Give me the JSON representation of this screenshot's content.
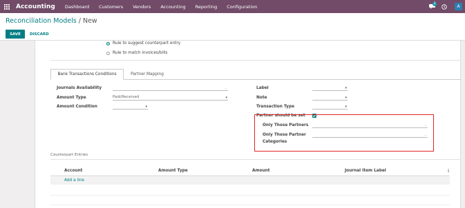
{
  "navbar": {
    "app_name": "Accounting",
    "menus": [
      "Dashboard",
      "Customers",
      "Vendors",
      "Accounting",
      "Reporting",
      "Configuration"
    ],
    "chat_count": "3",
    "avatar_letter": "A"
  },
  "breadcrumb": {
    "root": "Reconciliation Models",
    "separator": " / ",
    "current": "New"
  },
  "actions": {
    "save": "SAVE",
    "discard": "DISCARD"
  },
  "rule_type": {
    "options": [
      "Rule to suggest counterpart entry",
      "Rule to match invoices/bills"
    ],
    "selected": 0
  },
  "tabs": {
    "active": "Bank Transactions Conditions",
    "other": "Partner Mapping"
  },
  "conditions": {
    "journals_availability_label": "Journals Availability",
    "amount_type_label": "Amount Type",
    "amount_type_value": "Paid/Received",
    "amount_condition_label": "Amount Condition",
    "label_label": "Label",
    "note_label": "Note",
    "transaction_type_label": "Transaction Type",
    "partner_should_be_set_label": "Partner should be set",
    "partner_should_be_set": true,
    "only_those_partners_label": "Only Those Partners",
    "only_those_categories_line1": "Only Those Partner",
    "only_those_categories_line2": "Categories"
  },
  "counterpart": {
    "title": "Counterpart Entries",
    "columns": [
      "Account",
      "Amount Type",
      "Amount",
      "Journal Item Label"
    ],
    "add_line": "Add a line"
  },
  "colors": {
    "navbar": "#714b67",
    "accent": "#017e84",
    "highlight": "#e02323"
  }
}
